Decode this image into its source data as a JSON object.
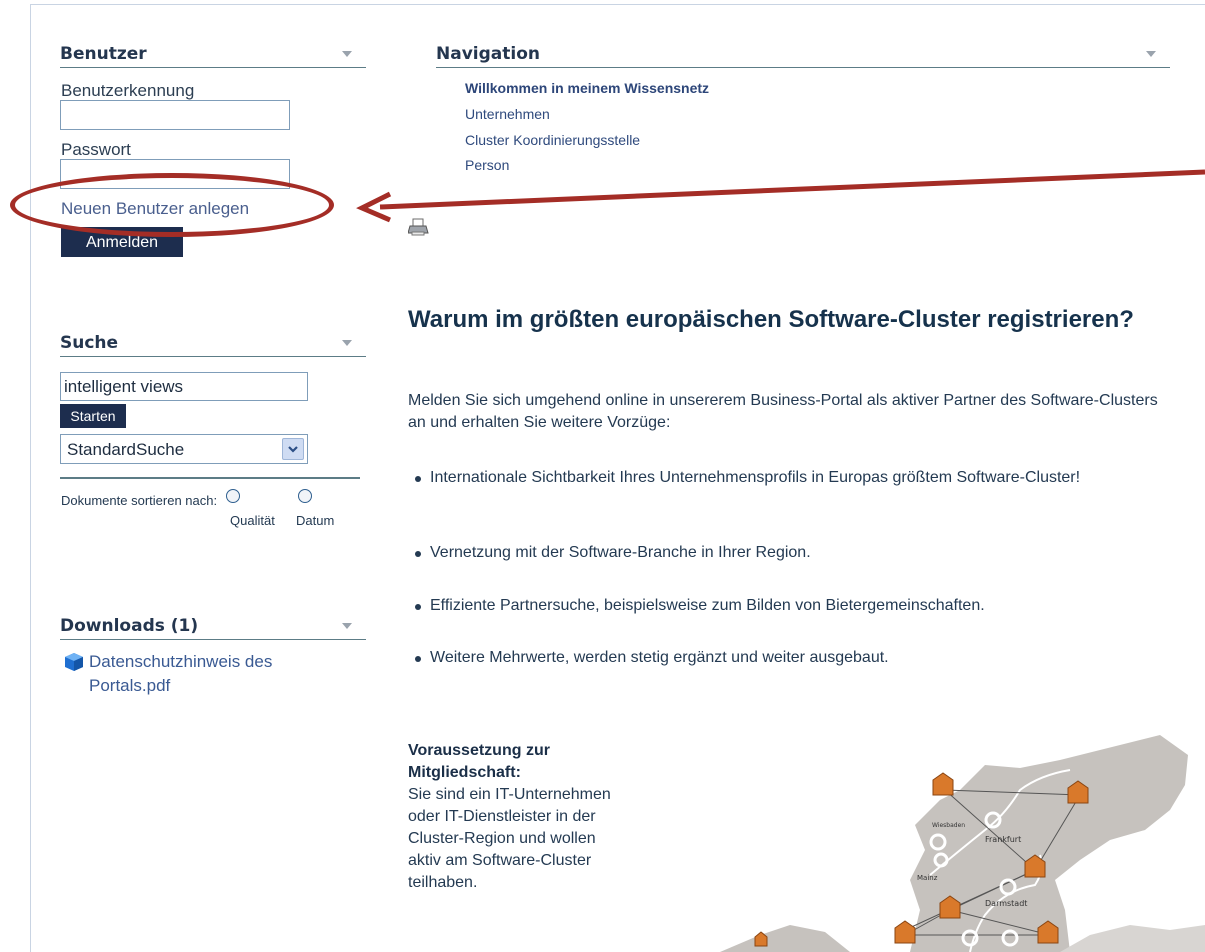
{
  "benutzer": {
    "title": "Benutzer",
    "username_label": "Benutzerkennung",
    "username_value": "",
    "password_label": "Passwort",
    "password_value": "",
    "new_user_link": "Neuen Benutzer anlegen",
    "login_button": "Anmelden"
  },
  "navigation": {
    "title": "Navigation",
    "items": [
      "Willkommen in meinem Wissensnetz",
      "Unternehmen",
      "Cluster Koordinierungsstelle",
      "Person"
    ]
  },
  "suche": {
    "title": "Suche",
    "query": "intelligent views",
    "start_button": "Starten",
    "mode_selected": "StandardSuche",
    "sort_label": "Dokumente sortieren nach:",
    "sort_option_1": "Qualität",
    "sort_option_2": "Datum"
  },
  "downloads": {
    "title": "Downloads (1)",
    "file_name": "Datenschutzhinweis des Portals.pdf"
  },
  "content": {
    "heading": "Warum im größten europäischen Software-Cluster registrieren?",
    "intro": "Melden Sie sich umgehend online in unsererem Business-Portal als aktiver Partner des Software-Clusters an und erhalten Sie weitere Vorzüge:",
    "bullets": [
      "Internationale Sichtbarkeit Ihres Unternehmensprofils in Europas größtem Software-Cluster!",
      "Vernetzung mit der Software-Branche in Ihrer Region.",
      "Effiziente Partnersuche, beispielsweise zum Bilden von Bietergemeinschaften.",
      "Weitere Mehrwerte, werden stetig ergänzt und weiter ausgebaut."
    ],
    "requirement_title": "Voraussetzung zur Mitgliedschaft:",
    "requirement_text": "Sie sind ein IT-Unternehmen oder IT-Dienstleister in der Cluster-Region und wollen aktiv am Software-Cluster teilhaben."
  },
  "map": {
    "cities": [
      "Wiesbaden",
      "Frankfurt",
      "Mainz",
      "Darmstadt"
    ]
  },
  "colors": {
    "annotation": "#a42d26",
    "button": "#1d2d4e",
    "map_region": "#c8c4c0",
    "map_house": "#d9792b"
  },
  "icons": [
    "printer-icon",
    "pdf-icon",
    "dropdown-arrow-icon",
    "collapse-triangle-icon"
  ]
}
